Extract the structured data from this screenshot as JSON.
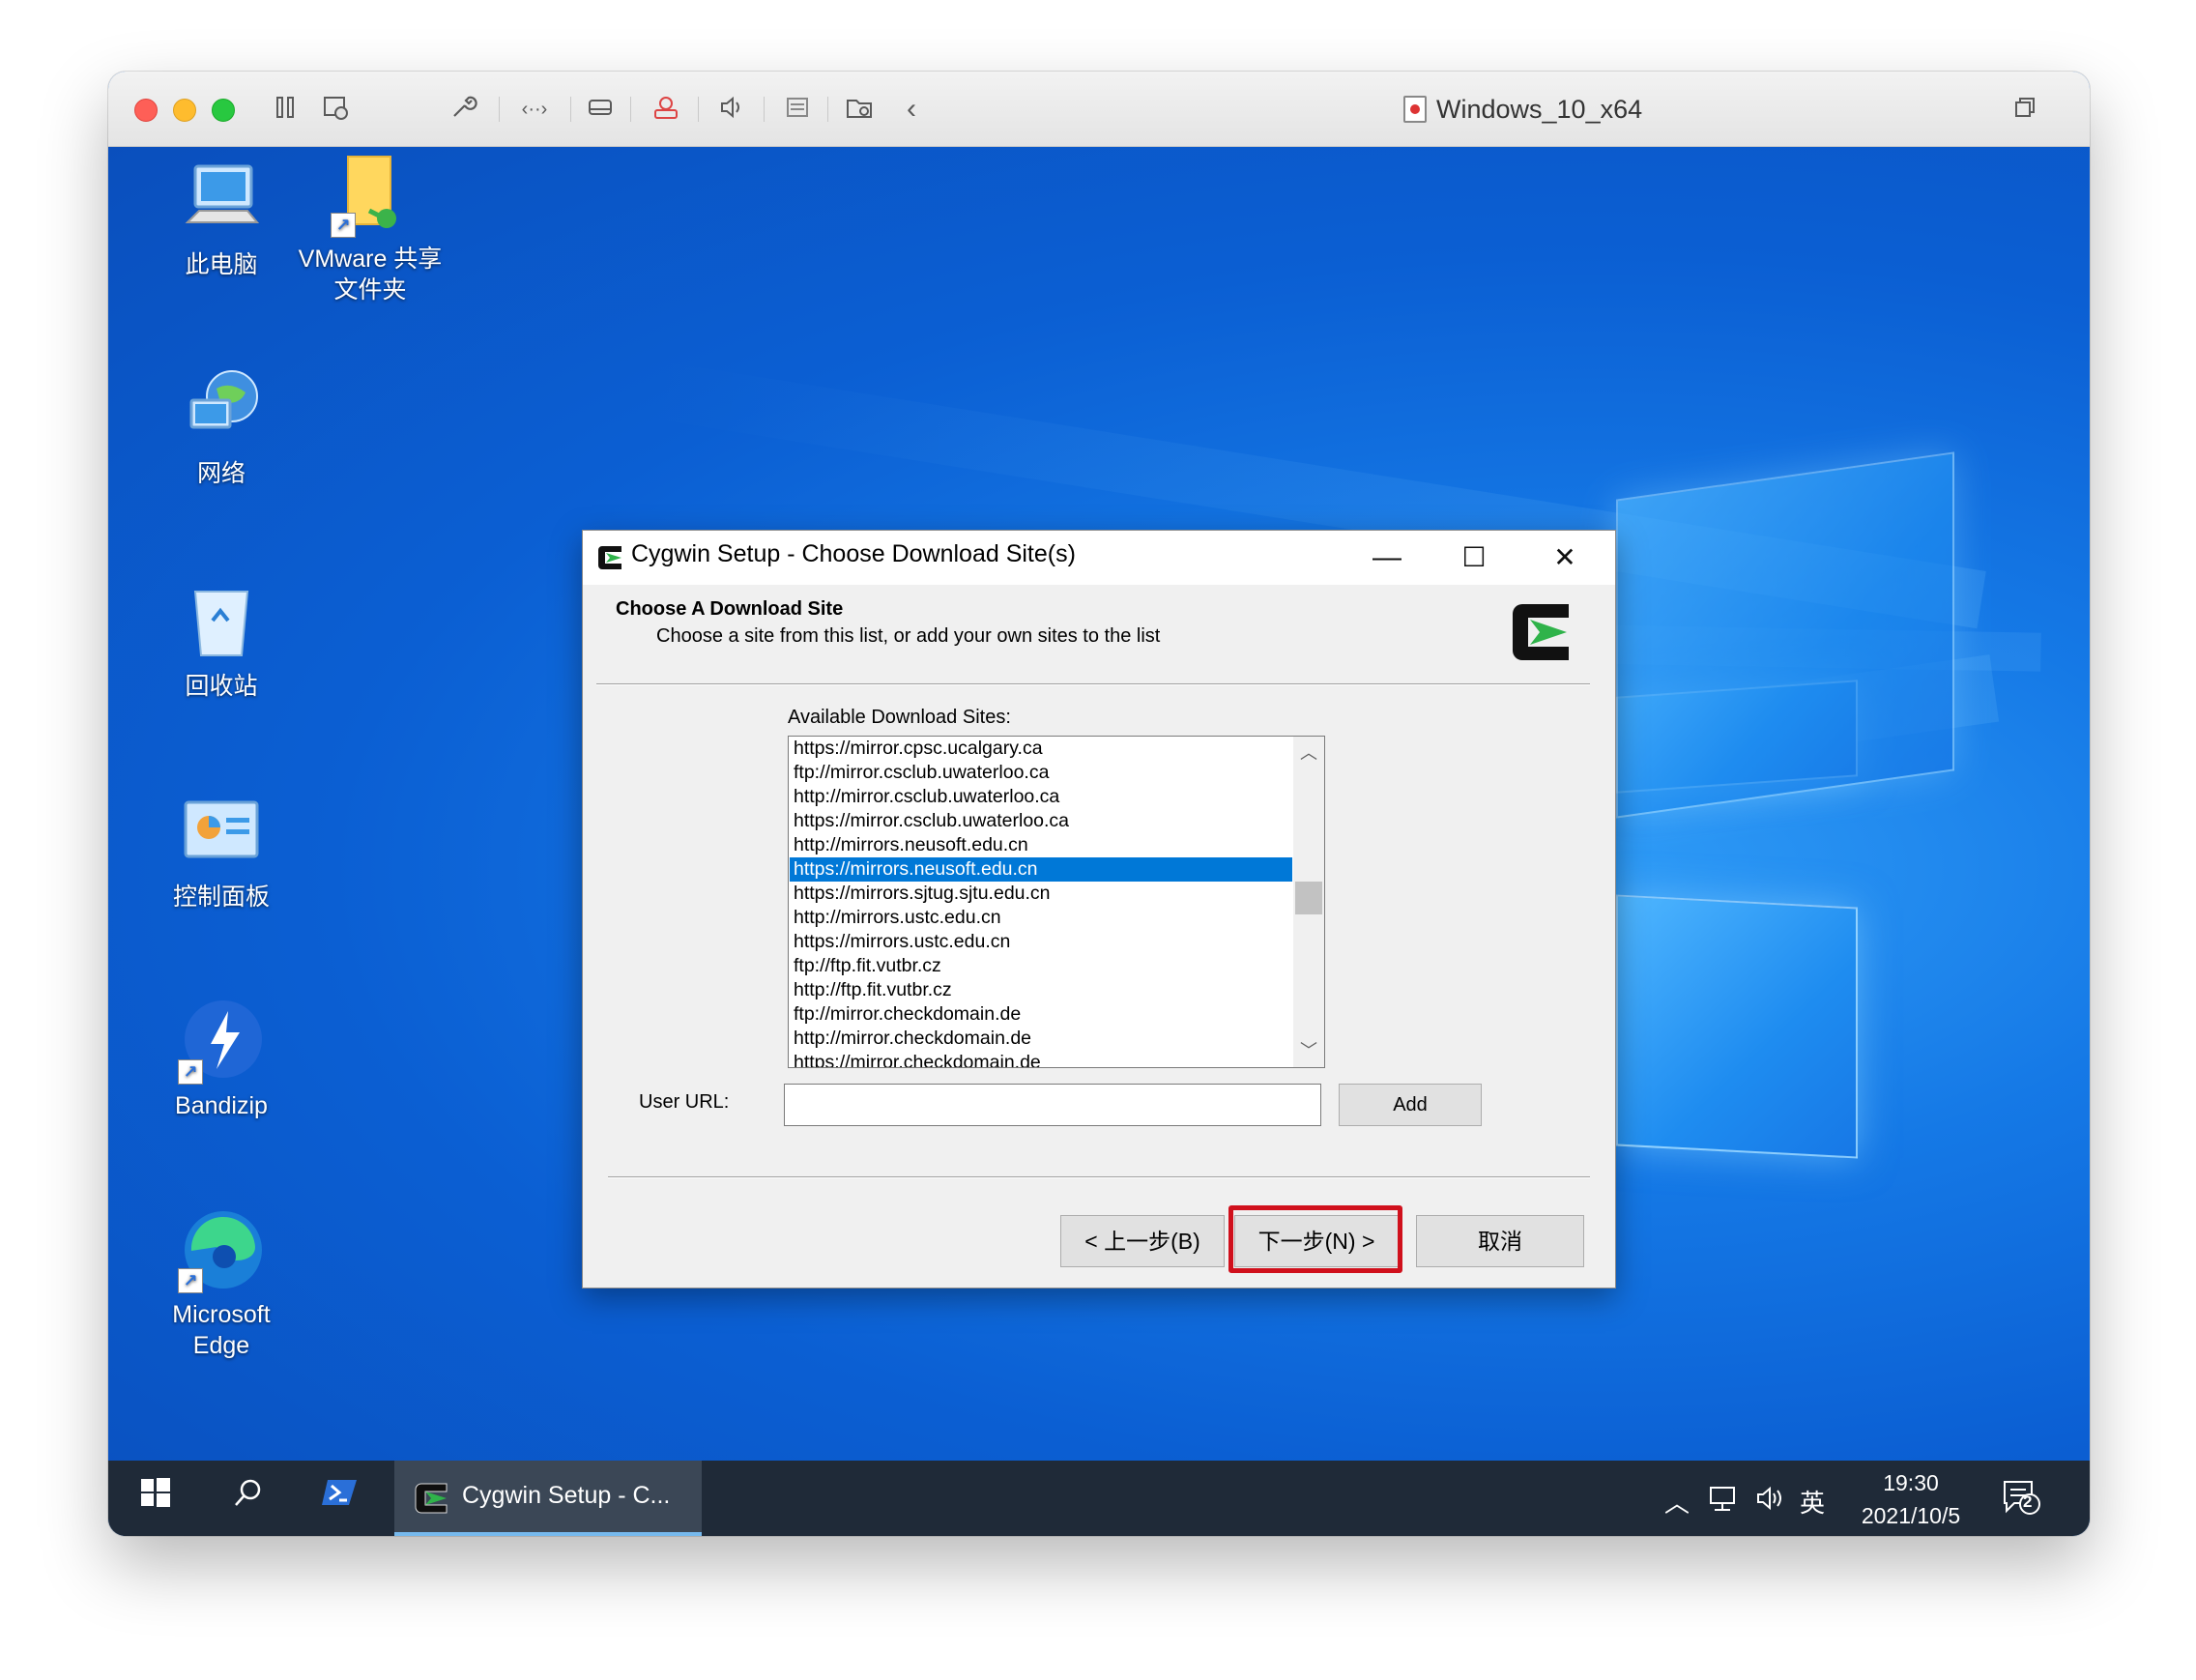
{
  "host_window": {
    "title": "Windows_10_x64"
  },
  "desktop": {
    "icons": [
      {
        "label": "此电脑",
        "label2": ""
      },
      {
        "label": "VMware 共享",
        "label2": "文件夹"
      },
      {
        "label": "网络",
        "label2": ""
      },
      {
        "label": "回收站",
        "label2": ""
      },
      {
        "label": "控制面板",
        "label2": ""
      },
      {
        "label": "Bandizip",
        "label2": ""
      },
      {
        "label": "Microsoft",
        "label2": "Edge"
      }
    ]
  },
  "dialog": {
    "title": "Cygwin Setup - Choose Download Site(s)",
    "controls": {
      "minimize": "—",
      "maximize": "☐",
      "close": "✕"
    },
    "header_title": "Choose A Download Site",
    "header_subtitle": "Choose a site from this list, or add your own sites to the list",
    "available_label": "Available Download Sites:",
    "sites": [
      "https://mirror.cpsc.ucalgary.ca",
      "ftp://mirror.csclub.uwaterloo.ca",
      "http://mirror.csclub.uwaterloo.ca",
      "https://mirror.csclub.uwaterloo.ca",
      "http://mirrors.neusoft.edu.cn",
      "https://mirrors.neusoft.edu.cn",
      "https://mirrors.sjtug.sjtu.edu.cn",
      "http://mirrors.ustc.edu.cn",
      "https://mirrors.ustc.edu.cn",
      "ftp://ftp.fit.vutbr.cz",
      "http://ftp.fit.vutbr.cz",
      "ftp://mirror.checkdomain.de",
      "http://mirror.checkdomain.de",
      "https://mirror.checkdomain.de"
    ],
    "selected_site": "https://mirrors.neusoft.edu.cn",
    "user_url_label": "User URL:",
    "user_url_value": "",
    "add_label": "Add",
    "back_label": "< 上一步(B)",
    "next_label": "下一步(N) >",
    "cancel_label": "取消"
  },
  "taskbar": {
    "app_label": "Cygwin Setup - C...",
    "ime": "英",
    "time": "19:30",
    "date": "2021/10/5",
    "notification_count": "2"
  },
  "colors": {
    "selection": "#0078d7",
    "highlight_border": "#d0101c",
    "taskbar": "#1f2a38"
  }
}
